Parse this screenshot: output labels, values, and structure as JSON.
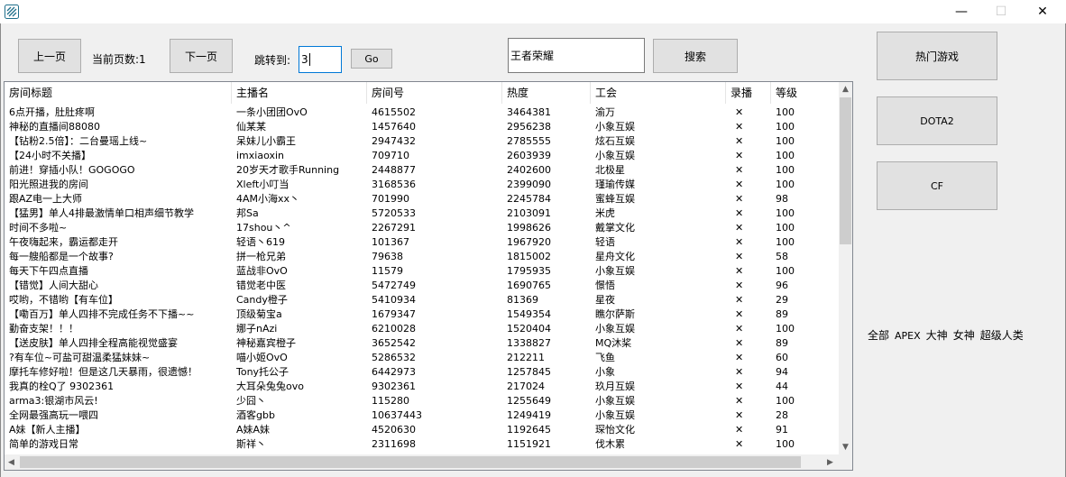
{
  "window": {
    "minimize_glyph": "—",
    "maximize_glyph": "☐",
    "close_glyph": "✕"
  },
  "toolbar": {
    "prev_label": "上一页",
    "current_page_label": "当前页数:1",
    "next_label": "下一页",
    "jump_label": "跳转到:",
    "jump_value": "3",
    "go_label": "Go",
    "search_value": "王者荣耀",
    "search_label": "搜索"
  },
  "side": {
    "hot_games_label": "热门游戏",
    "dota2_label": "DOTA2",
    "cf_label": "CF",
    "tags": [
      "全部",
      "APEX",
      "大神",
      "女神",
      "超级人类"
    ]
  },
  "table": {
    "columns": [
      "房间标题",
      "主播名",
      "房间号",
      "热度",
      "工会",
      "录播",
      "等级"
    ],
    "rows": [
      [
        "6点开播，肚肚疼啊",
        "一条小团团OvO",
        "4615502",
        "3464381",
        "渝万",
        "✕",
        "100"
      ],
      [
        "神秘的直播间88080",
        "仙某某",
        "1457640",
        "2956238",
        "小象互娱",
        "✕",
        "100"
      ],
      [
        "【钻粉2.5倍】：二台曼瑶上线~",
        "呆妹儿小霸王",
        "2947432",
        "2785555",
        "炫石互娱",
        "✕",
        "100"
      ],
      [
        "【24小时不关播】",
        "imxiaoxin",
        "709710",
        "2603939",
        "小象互娱",
        "✕",
        "100"
      ],
      [
        "前进！穿插小队！GOGOGO",
        "20岁天才歌手Running",
        "2448877",
        "2402600",
        "北极星",
        "✕",
        "100"
      ],
      [
        "阳光照进我的房间",
        "Xleft小叮当",
        "3168536",
        "2399090",
        "瑾瑜传媒",
        "✕",
        "100"
      ],
      [
        "跟AZ电一上大师",
        "4AM小海xx丶",
        "701990",
        "2245784",
        "蜜蜂互娱",
        "✕",
        "98"
      ],
      [
        "【猛男】单人4排最激情单口相声细节教学",
        "邦Sa",
        "5720533",
        "2103091",
        "米虎",
        "✕",
        "100"
      ],
      [
        "时间不多啦~",
        "17shou丶^",
        "2267291",
        "1998626",
        "戴掌文化",
        "✕",
        "100"
      ],
      [
        "午夜嗨起来，霸运都走开",
        "轻语丶619",
        "101367",
        "1967920",
        "轻语",
        "✕",
        "100"
      ],
      [
        "每一艘船都是一个故事?",
        "拼一枪兄弟",
        "79638",
        "1815002",
        "星舟文化",
        "✕",
        "58"
      ],
      [
        "每天下午四点直播",
        "蓝战非OvO",
        "11579",
        "1795935",
        "小象互娱",
        "✕",
        "100"
      ],
      [
        "【错觉】人间大甜心",
        "错觉老中医",
        "5472749",
        "1690765",
        "憬悟",
        "✕",
        "96"
      ],
      [
        "哎哟，不错哟【有车位】",
        "Candy橙子",
        "5410934",
        "81369",
        "星夜",
        "✕",
        "29"
      ],
      [
        "【嘞百万】单人四排不完成任务不下播~~",
        "顶级菊宝a",
        "1679347",
        "1549354",
        "瞧尔萨斯",
        "✕",
        "89"
      ],
      [
        "勤奋支架！！！",
        "娜子nAzi",
        "6210028",
        "1520404",
        "小象互娱",
        "✕",
        "100"
      ],
      [
        "【送皮肤】单人四排全程高能视觉盛宴",
        "神秘嘉宾橙子",
        "3652542",
        "1338827",
        "MQ沐桨",
        "✕",
        "89"
      ],
      [
        "?有车位~可盐可甜温柔猛妹妹~",
        "喵小姬OvO",
        "5286532",
        "212211",
        "飞鱼",
        "✕",
        "60"
      ],
      [
        "摩托车修好啦！但是这几天暴雨，很遗憾！",
        "Tony托公子",
        "6442973",
        "1257845",
        "小象",
        "✕",
        "94"
      ],
      [
        "我真的栓Q了 9302361",
        "大耳朵兔兔ovo",
        "9302361",
        "217024",
        "玖月互娱",
        "✕",
        "44"
      ],
      [
        "arma3:银湖市风云!",
        "少囧丶",
        "115280",
        "1255649",
        "小象互娱",
        "✕",
        "100"
      ],
      [
        "全网最强高玩一喂四",
        "酒客gbb",
        "10637443",
        "1249419",
        "小象互娱",
        "✕",
        "28"
      ],
      [
        "A妹【新人主播】",
        "A妹A妹",
        "4520630",
        "1192645",
        "琛怡文化",
        "✕",
        "91"
      ],
      [
        "简单的游戏日常",
        "斯祥丶",
        "2311698",
        "1151921",
        "伐木累",
        "✕",
        "100"
      ]
    ]
  }
}
